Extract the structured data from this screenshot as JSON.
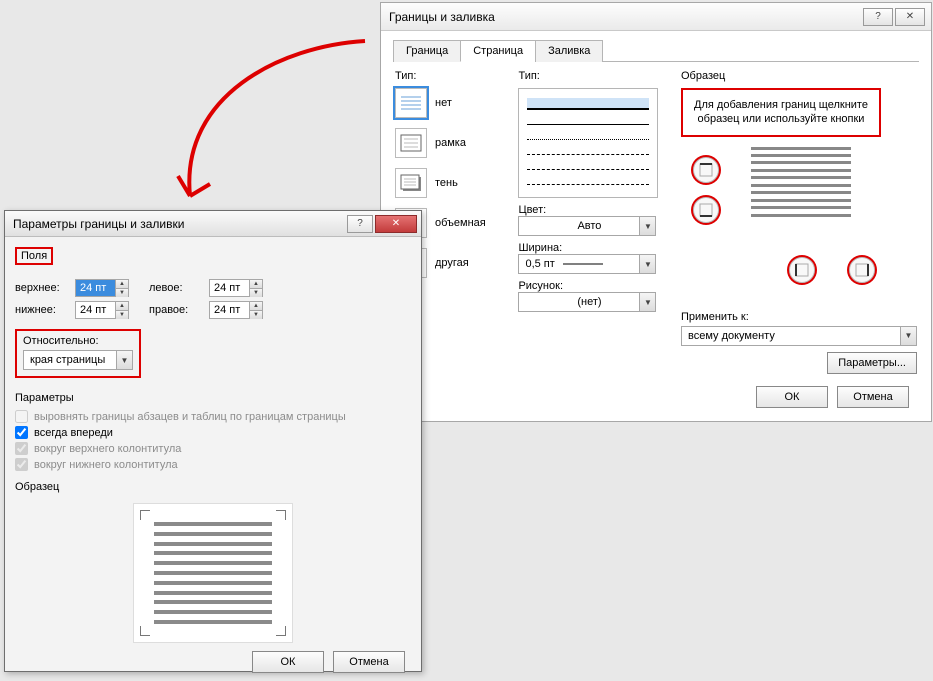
{
  "main_dialog": {
    "title": "Границы и заливка",
    "help_glyph": "?",
    "close_glyph": "✕",
    "tabs": {
      "border": "Граница",
      "page": "Страница",
      "fill": "Заливка"
    },
    "type_label": "Тип:",
    "style_label": "Тип:",
    "types": [
      {
        "key": "none",
        "label": "нет"
      },
      {
        "key": "box",
        "label": "рамка"
      },
      {
        "key": "shadow",
        "label": "тень"
      },
      {
        "key": "threed",
        "label": "объемная"
      },
      {
        "key": "custom",
        "label": "другая"
      }
    ],
    "color_label": "Цвет:",
    "color_value": "Авто",
    "width_label": "Ширина:",
    "width_value": "0,5 пт",
    "art_label": "Рисунок:",
    "art_value": "(нет)",
    "preview_label": "Образец",
    "preview_hint": "Для добавления границ щелкните образец или используйте кнопки",
    "apply_label": "Применить к:",
    "apply_value": "всему документу",
    "params_btn": "Параметры...",
    "ok": "ОК",
    "cancel": "Отмена"
  },
  "options_dialog": {
    "title": "Параметры границы и заливки",
    "help_glyph": "?",
    "close_glyph": "✕",
    "fields_label": "Поля",
    "margins": {
      "top_label": "верхнее:",
      "top_value": "24 пт",
      "left_label": "левое:",
      "left_value": "24 пт",
      "bottom_label": "нижнее:",
      "bottom_value": "24 пт",
      "right_label": "правое:",
      "right_value": "24 пт"
    },
    "relative_label": "Относительно:",
    "relative_value": "края страницы",
    "params_label": "Параметры",
    "checks": {
      "align_para": "выровнять границы абзацев и таблиц по границам страницы",
      "always_front": "всегда впереди",
      "around_header": "вокруг верхнего колонтитула",
      "around_footer": "вокруг нижнего колонтитула"
    },
    "preview_label": "Образец",
    "ok": "ОК",
    "cancel": "Отмена"
  }
}
